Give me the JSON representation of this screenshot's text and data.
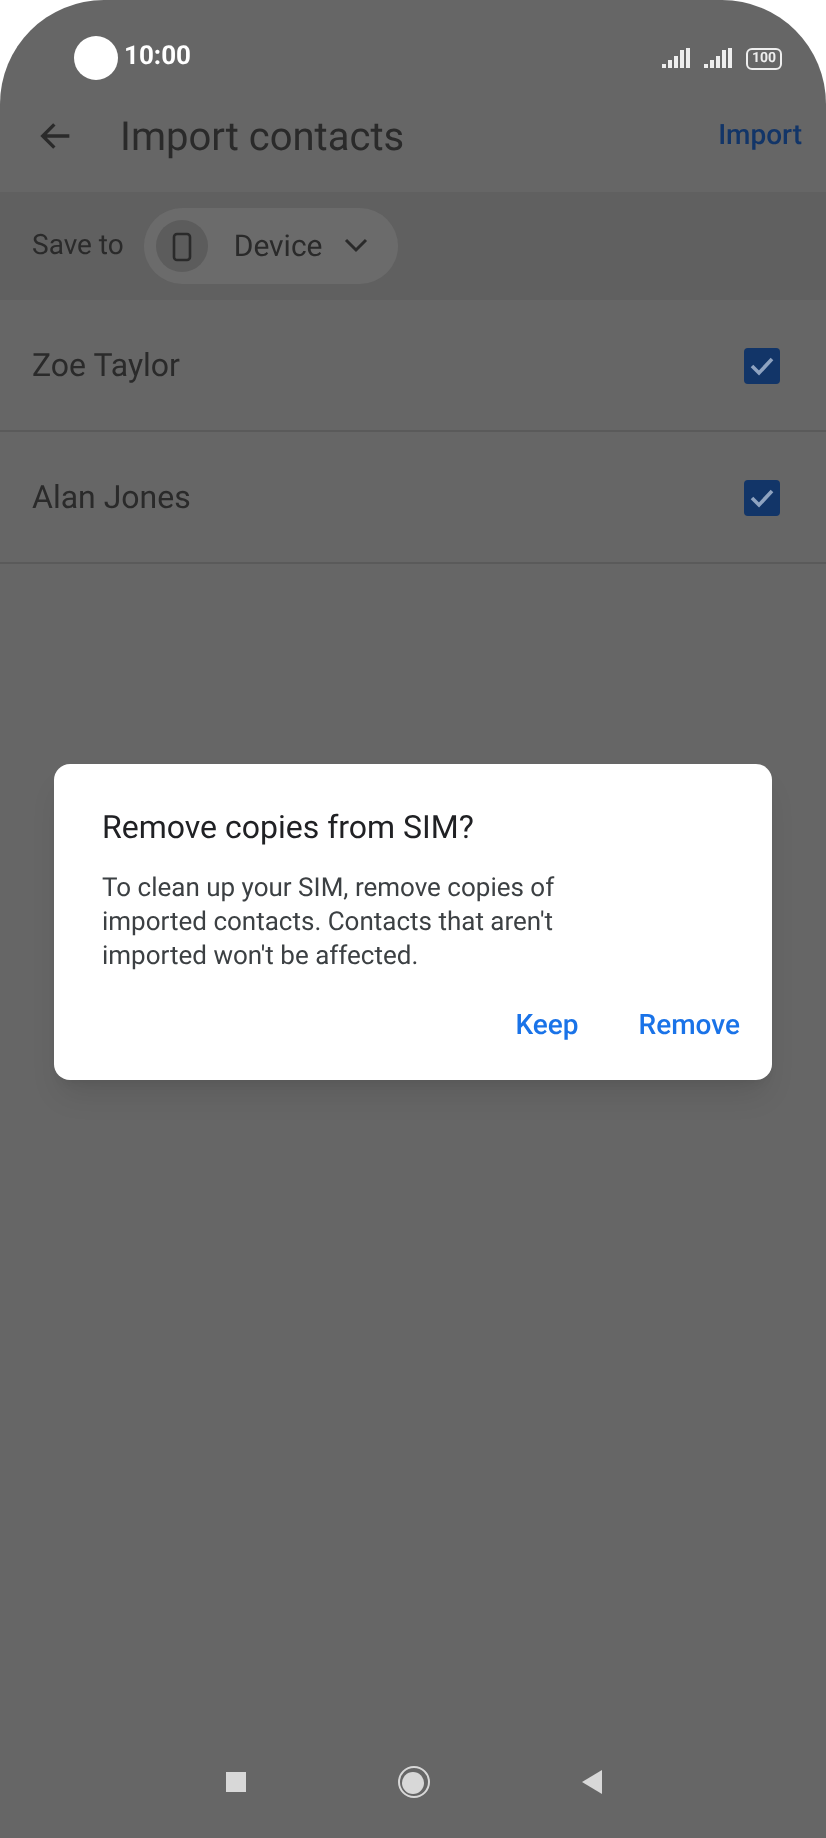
{
  "status_bar": {
    "time": "10:00",
    "battery": "100"
  },
  "app_bar": {
    "title": "Import contacts",
    "action": "Import"
  },
  "save_to": {
    "label": "Save to",
    "account": "Device"
  },
  "contacts": [
    {
      "name": "Zoe Taylor",
      "checked": true
    },
    {
      "name": "Alan Jones",
      "checked": true
    }
  ],
  "dialog": {
    "title": "Remove copies from SIM?",
    "message": "To clean up your SIM, remove copies of imported contacts. Contacts that aren't imported won't be affected.",
    "buttons": [
      "Keep",
      "Remove"
    ]
  }
}
